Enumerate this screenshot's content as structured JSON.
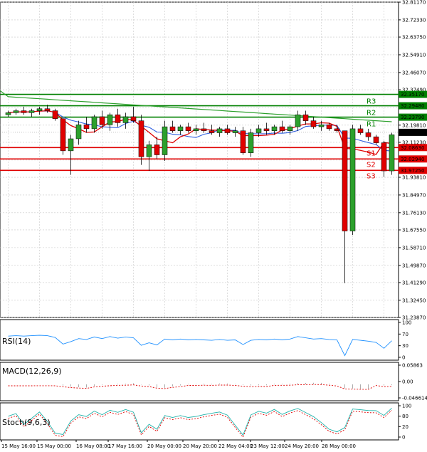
{
  "chart_data": {
    "type": "candlestick",
    "instrument_hint": "",
    "y_ticks": [
      "32.81170",
      "32.72330",
      "32.63750",
      "32.54910",
      "32.46070",
      "32.37490",
      "32.28650",
      "32.19810",
      "32.11230",
      "32.02390",
      "31.93810",
      "31.84970",
      "31.76130",
      "31.67550",
      "31.58710",
      "31.49870",
      "31.41290",
      "31.32450",
      "31.23870"
    ],
    "ylim": [
      31.2387,
      32.8117
    ],
    "last_price": "32.16225",
    "x_ticks": [
      "15 May 16:00",
      "15 May 00:00",
      "16 May 08:00",
      "17 May 16:00",
      "20 May 00:00",
      "20 May 20:00",
      "22 May 04:00",
      "23 May 12:00",
      "24 May 20:00",
      "28 May 00:00"
    ],
    "levels": [
      {
        "name": "R3",
        "value": 32.3517,
        "label": "32.35170",
        "color": "#008000"
      },
      {
        "name": "R2",
        "value": 32.2948,
        "label": "32.29480",
        "color": "#008000"
      },
      {
        "name": "R1",
        "value": 32.2379,
        "label": "32.23790",
        "color": "#008000"
      },
      {
        "name": "S1",
        "value": 32.0863,
        "label": "32.08630",
        "color": "#e00000"
      },
      {
        "name": "S2",
        "value": 32.0294,
        "label": "32.02940",
        "color": "#e00000"
      },
      {
        "name": "S3",
        "value": 31.9725,
        "label": "31.97250",
        "color": "#e00000"
      }
    ],
    "candles": [
      [
        32.25,
        32.27,
        32.24,
        32.26
      ],
      [
        32.26,
        32.28,
        32.25,
        32.27
      ],
      [
        32.27,
        32.29,
        32.25,
        32.26
      ],
      [
        32.26,
        32.28,
        32.24,
        32.27
      ],
      [
        32.27,
        32.29,
        32.25,
        32.28
      ],
      [
        32.28,
        32.3,
        32.26,
        32.27
      ],
      [
        32.27,
        32.28,
        32.22,
        32.23
      ],
      [
        32.23,
        32.24,
        32.05,
        32.07
      ],
      [
        32.07,
        32.15,
        31.95,
        32.13
      ],
      [
        32.13,
        32.22,
        32.1,
        32.2
      ],
      [
        32.2,
        32.24,
        32.16,
        32.18
      ],
      [
        32.18,
        32.25,
        32.16,
        32.24
      ],
      [
        32.24,
        32.27,
        32.18,
        32.2
      ],
      [
        32.2,
        32.26,
        32.17,
        32.25
      ],
      [
        32.25,
        32.28,
        32.19,
        32.21
      ],
      [
        32.21,
        32.26,
        32.18,
        32.24
      ],
      [
        32.24,
        32.29,
        32.21,
        32.22
      ],
      [
        32.22,
        32.25,
        32.0,
        32.04
      ],
      [
        32.04,
        32.12,
        31.97,
        32.1
      ],
      [
        32.1,
        32.14,
        32.03,
        32.05
      ],
      [
        32.05,
        32.22,
        32.02,
        32.19
      ],
      [
        32.19,
        32.22,
        32.16,
        32.17
      ],
      [
        32.17,
        32.2,
        32.15,
        32.19
      ],
      [
        32.19,
        32.21,
        32.16,
        32.17
      ],
      [
        32.17,
        32.2,
        32.15,
        32.18
      ],
      [
        32.18,
        32.21,
        32.16,
        32.17
      ],
      [
        32.17,
        32.2,
        32.15,
        32.16
      ],
      [
        32.16,
        32.19,
        32.14,
        32.18
      ],
      [
        32.18,
        32.2,
        32.15,
        32.16
      ],
      [
        32.16,
        32.19,
        32.14,
        32.17
      ],
      [
        32.17,
        32.19,
        32.05,
        32.06
      ],
      [
        32.06,
        32.18,
        32.04,
        32.16
      ],
      [
        32.16,
        32.2,
        32.14,
        32.18
      ],
      [
        32.18,
        32.21,
        32.15,
        32.17
      ],
      [
        32.17,
        32.2,
        32.15,
        32.19
      ],
      [
        32.19,
        32.22,
        32.16,
        32.17
      ],
      [
        32.17,
        32.2,
        32.15,
        32.19
      ],
      [
        32.19,
        32.27,
        32.17,
        32.25
      ],
      [
        32.25,
        32.27,
        32.2,
        32.22
      ],
      [
        32.22,
        32.24,
        32.18,
        32.19
      ],
      [
        32.19,
        32.22,
        32.17,
        32.2
      ],
      [
        32.2,
        32.21,
        32.17,
        32.18
      ],
      [
        32.18,
        32.2,
        32.16,
        32.17
      ],
      [
        32.17,
        32.17,
        31.41,
        31.67
      ],
      [
        31.67,
        32.2,
        31.65,
        32.18
      ],
      [
        32.18,
        32.2,
        32.15,
        32.16
      ],
      [
        32.16,
        32.18,
        32.12,
        32.14
      ],
      [
        32.14,
        32.15,
        32.1,
        32.11
      ],
      [
        32.11,
        32.12,
        31.94,
        31.97
      ],
      [
        31.97,
        32.16,
        31.95,
        32.15
      ]
    ],
    "rsi": {
      "label": "RSI(14)",
      "ticks": [
        "100",
        "70",
        "30",
        "0"
      ]
    },
    "macd": {
      "label": "MACD(12,26,9)",
      "ticks": [
        "0.05863",
        "0.00",
        "-0.046614"
      ]
    },
    "stoch": {
      "label": "Stoch(9,6,3)",
      "ticks": [
        "100",
        "80",
        "20",
        "0"
      ]
    }
  }
}
